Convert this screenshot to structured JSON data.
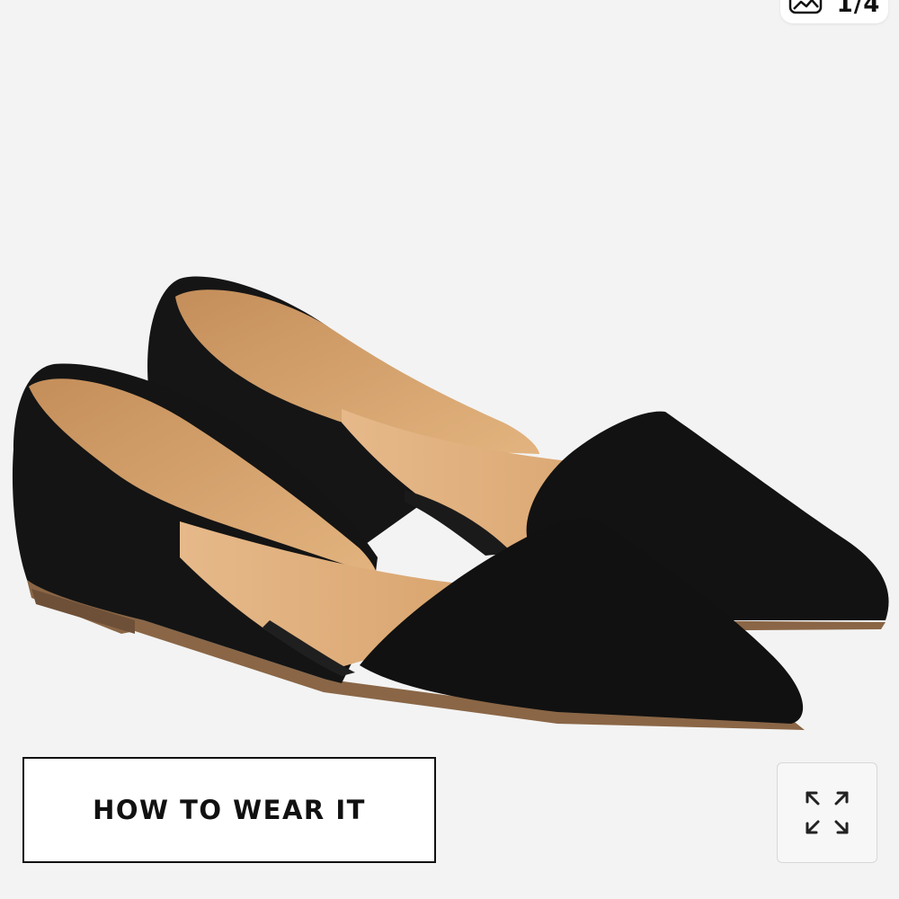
{
  "gallery": {
    "counter": "1/4",
    "icon": "gallery-icon"
  },
  "product": {
    "image_subject": "black suede d'orsay pointed-toe flats",
    "colors": {
      "suede": "#111111",
      "lining": "#d9a874",
      "sole": "#8a6646",
      "background": "#f3f3f3"
    }
  },
  "actions": {
    "how_to_wear_label": "HOW TO WEAR IT",
    "expand_icon": "expand-arrows-icon"
  }
}
